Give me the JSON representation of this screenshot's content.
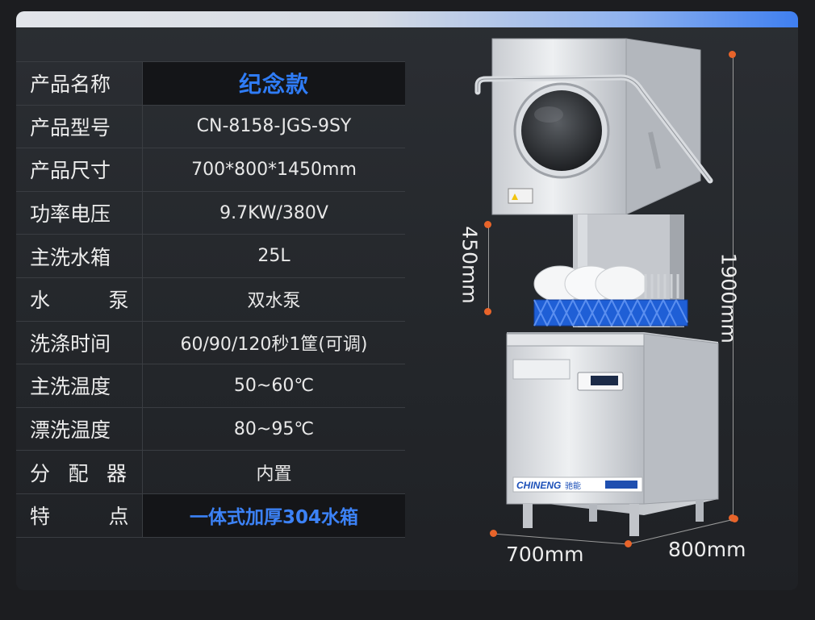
{
  "specs": [
    {
      "key": "产品名称",
      "value": "纪念款"
    },
    {
      "key": "产品型号",
      "value": "CN-8158-JGS-9SY"
    },
    {
      "key": "产品尺寸",
      "value": "700*800*1450mm"
    },
    {
      "key": "功率电压",
      "value": "9.7KW/380V"
    },
    {
      "key": "主洗水箱",
      "value": "25L"
    },
    {
      "key": "水泵",
      "value": "双水泵"
    },
    {
      "key": "洗涤时间",
      "value": "60/90/120秒1筐(可调)"
    },
    {
      "key": "主洗温度",
      "value": "50~60℃"
    },
    {
      "key": "漂洗温度",
      "value": "80~95℃"
    },
    {
      "key": "分配器",
      "value": "内置"
    },
    {
      "key": "特点",
      "value": "一体式加厚304水箱"
    }
  ],
  "dimensions": {
    "opening_height": "450mm",
    "total_height": "1900mm",
    "width": "700mm",
    "depth": "800mm"
  },
  "brand": {
    "logo_text": "CHINENG",
    "logo_cn": "驰能"
  },
  "colors": {
    "accent": "#2f7cf6",
    "dimension_dot": "#e8642a"
  }
}
